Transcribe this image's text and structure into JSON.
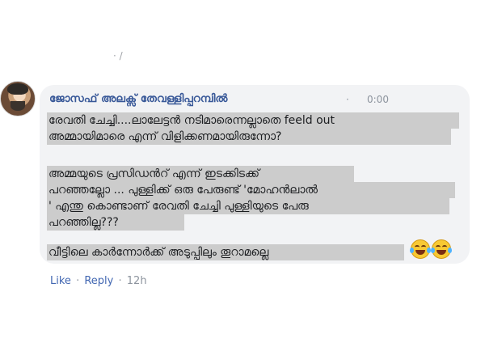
{
  "top_mark": "· /",
  "comment": {
    "author": "ജോസഫ് അലക്സ് തേവള്ളിപ്പറമ്പിൽ",
    "separator": "·",
    "time": "0:00",
    "lines": [
      "രേവതി ചേച്ചി....ലാലേട്ടൻ നടിമാരെന്നല്ലാതെ feeld out",
      "അമ്മായിമാരെ എന്ന് വിളിക്കണമായിരുന്നോ?",
      "അമ്മയുടെ പ്രസിഡൻറ് എന്ന് ഇടക്കിടക്ക്",
      "പറഞ്ഞല്ലോ ... പുള്ളിക്ക് ഒരു പേരുണ്ട് 'മോഹൻലാൽ",
      "' എന്തു കൊണ്ടാണ് രേവതി ചേച്ചി പുള്ളിയുടെ പേരു",
      "പറഞ്ഞില്ല???",
      "വീട്ടിലെ കാർന്നോർക്ക് അടുപ്പിലും തൂറാമല്ലെ"
    ],
    "emojis": [
      "tears-of-joy-emoji",
      "tears-of-joy-emoji"
    ]
  },
  "actions": {
    "like": "Like",
    "reply": "Reply",
    "dot": "·",
    "age": "12h"
  }
}
